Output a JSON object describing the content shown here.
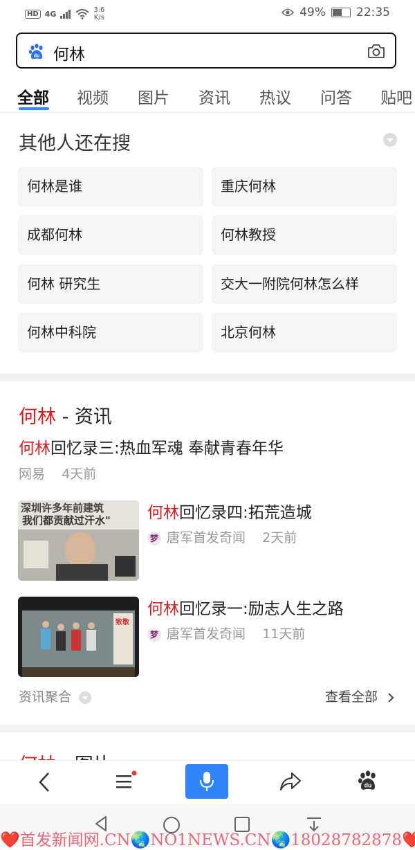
{
  "status_bar": {
    "hd": "HD",
    "network": "4G",
    "speed_value": "3.6",
    "speed_unit": "K/s",
    "battery_text": "49%",
    "battery_level": 0.49,
    "time": "22:35"
  },
  "search": {
    "query": "何林",
    "logo_text": "du"
  },
  "tabs": [
    {
      "label": "全部",
      "active": true
    },
    {
      "label": "视频"
    },
    {
      "label": "图片"
    },
    {
      "label": "资讯"
    },
    {
      "label": "热议"
    },
    {
      "label": "问答"
    },
    {
      "label": "贴吧"
    }
  ],
  "related": {
    "title": "其他人还在搜",
    "items": [
      "何林是谁",
      "重庆何林",
      "成都何林",
      "何林教授",
      "何林 研究生",
      "交大一附院何林怎么样",
      "何林中科院",
      "北京何林"
    ]
  },
  "news": {
    "title_keyword": "何林",
    "title_suffix": " - 资讯",
    "articles": [
      {
        "keyword": "何林",
        "rest": "回忆录三:热血军魂 奉献青春年华",
        "source": "网易",
        "time": "4天前"
      },
      {
        "keyword": "何林",
        "rest": "回忆录四:拓荒造城",
        "source_icon": "梦",
        "source": "唐军首发奇闻",
        "time": "2天前"
      },
      {
        "keyword": "何林",
        "rest": "回忆录一:励志人生之路",
        "source_icon": "梦",
        "source": "唐军首发奇闻",
        "time": "11天前"
      }
    ],
    "thumb1_text_line1": "深圳许多年前建筑",
    "thumb1_text_line2": "我们都贡献过汗水\"",
    "thumb2_text": "致敬",
    "footer_left": "资讯聚合",
    "footer_right": "查看全部"
  },
  "next_section": {
    "keyword": "何林",
    "suffix": " - 图片"
  },
  "watermark": "❤️首发新闻网.CN🌏NO1NEWS.CN🌏18028782878❤️",
  "colors": {
    "accent_blue": "#3388ff",
    "keyword_red": "#d02020",
    "mic_blue": "#2f84f8"
  }
}
